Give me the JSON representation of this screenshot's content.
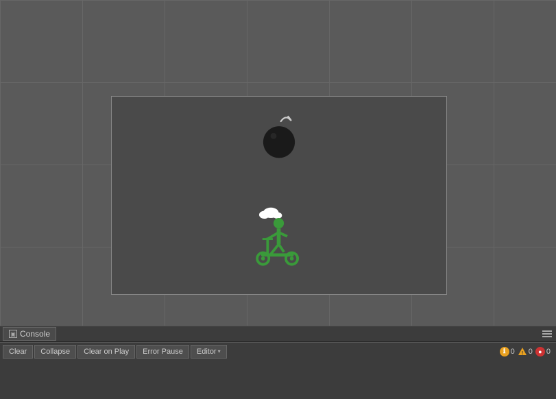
{
  "mainView": {
    "backgroundColor": "#5a5a5a",
    "gridColor": "#676767"
  },
  "console": {
    "tabLabel": "Console",
    "tabIconLabel": "≡"
  },
  "toolbar": {
    "clearLabel": "Clear",
    "collapseLabel": "Collapse",
    "clearOnPlayLabel": "Clear on Play",
    "errorPauseLabel": "Error Pause",
    "editorLabel": "Editor",
    "editorDropdownArrow": "▾"
  },
  "statusBar": {
    "warningCount": "0",
    "errorTriCount": "0",
    "errorCircleCount": "0",
    "warningIcon": "⚠",
    "errorIcon": "●",
    "infoIcon": "ℹ"
  },
  "scene": {
    "bomb": {
      "fuse": "~",
      "body": "●"
    },
    "scooterColor": "#3a9a3a",
    "bombColor": "#1a1a1a"
  }
}
